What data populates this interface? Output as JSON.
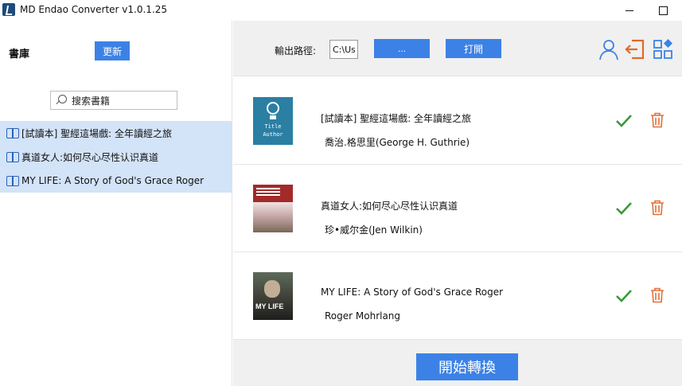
{
  "window": {
    "title": "MD Endao Converter v1.0.1.25"
  },
  "sidebar": {
    "library_label": "書庫",
    "update_label": "更新",
    "search_placeholder": "搜索書籍",
    "items": [
      {
        "label": "[試讀本] 聖經這場戲: 全年讀經之旅"
      },
      {
        "label": "真道女人:如何尽心尽性认识真道"
      },
      {
        "label": "MY LIFE: A Story of God's Grace Roger"
      }
    ]
  },
  "toolbar": {
    "output_path_label": "輸出路徑:",
    "output_path_value": "C:\\Users",
    "browse_label": "...",
    "open_label": "打開"
  },
  "books": [
    {
      "title": "[試讀本] 聖經這場戲: 全年讀經之旅",
      "author": "喬治.格思里(George H. Guthrie)",
      "cover_title": "Title",
      "cover_author": "Author"
    },
    {
      "title": "真道女人:如何尽心尽性认识真道",
      "author": "珍•威尔金(Jen Wilkin)"
    },
    {
      "title": "MY LIFE: A Story of God's Grace Roger",
      "author": "Roger Mohrlang",
      "cover_text": "MY LIFE"
    }
  ],
  "footer": {
    "start_label": "開始轉換"
  },
  "icons": {
    "user": "user-icon",
    "login": "login-icon",
    "apps": "apps-icon",
    "check": "check-icon",
    "trash": "trash-icon",
    "book": "book-icon",
    "search": "search-icon"
  },
  "colors": {
    "accent_blue": "#3c82e6",
    "selected_row": "#d3e3f8",
    "check_green": "#3a9a3a",
    "trash_orange": "#e0703a",
    "login_orange": "#e06a2a"
  }
}
